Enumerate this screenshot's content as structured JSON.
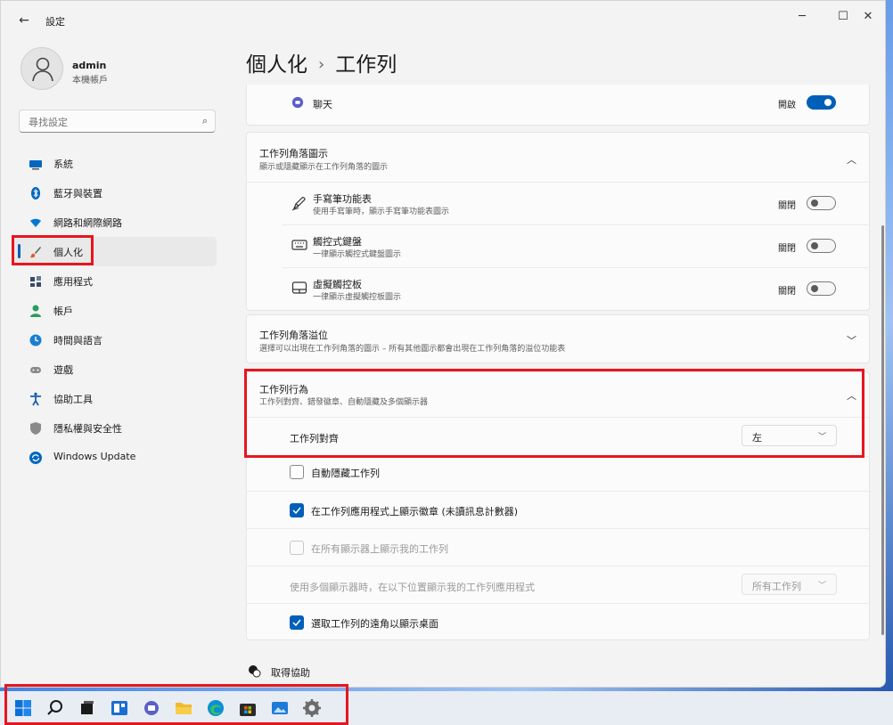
{
  "window": {
    "title": "設定",
    "back_icon": "back-arrow-icon"
  },
  "controls": {
    "minimize": "─",
    "maximize": "☐",
    "close": "✕"
  },
  "user": {
    "name": "admin",
    "account_type": "本機帳戶"
  },
  "search": {
    "placeholder": "尋找設定",
    "icon": "⌕"
  },
  "nav": [
    {
      "label": "系統",
      "icon": "system-icon",
      "color": "#0067c0"
    },
    {
      "label": "藍牙與裝置",
      "icon": "bluetooth-icon",
      "color": "#0067c0"
    },
    {
      "label": "網路和網際網路",
      "icon": "network-icon",
      "color": "#0078d4"
    },
    {
      "label": "個人化",
      "icon": "brush-icon",
      "color": "#e05a2b",
      "active": true
    },
    {
      "label": "應用程式",
      "icon": "apps-icon",
      "color": "#3a4a6a"
    },
    {
      "label": "帳戶",
      "icon": "account-icon",
      "color": "#2a9d5c"
    },
    {
      "label": "時間與語言",
      "icon": "time-language-icon",
      "color": "#1a7fd4"
    },
    {
      "label": "遊戲",
      "icon": "gaming-icon",
      "color": "#7a7a7a"
    },
    {
      "label": "協助工具",
      "icon": "accessibility-icon",
      "color": "#1a5fb4"
    },
    {
      "label": "隱私權與安全性",
      "icon": "shield-icon",
      "color": "#6b6b6b"
    },
    {
      "label": "Windows Update",
      "icon": "windows-update-icon",
      "color": "#0067c0"
    }
  ],
  "breadcrumb": {
    "parent": "個人化",
    "separator": "›",
    "current": "工作列"
  },
  "chat": {
    "label": "聊天",
    "state": "開啟"
  },
  "corner_icons": {
    "title": "工作列角落圖示",
    "subtitle": "顯示或隱藏顯示在工作列角落的圖示",
    "items": [
      {
        "title": "手寫筆功能表",
        "subtitle": "使用手寫筆時，顯示手寫筆功能表圖示",
        "state": "關閉"
      },
      {
        "title": "觸控式鍵盤",
        "subtitle": "一律顯示觸控式鍵盤圖示",
        "state": "關閉"
      },
      {
        "title": "虛擬觸控板",
        "subtitle": "一律顯示虛擬觸控板圖示",
        "state": "關閉"
      }
    ]
  },
  "overflow": {
    "title": "工作列角落溢位",
    "subtitle": "選擇可以出現在工作列角落的圖示 – 所有其他圖示都會出現在工作列角落的溢位功能表"
  },
  "behaviors": {
    "title": "工作列行為",
    "subtitle": "工作列對齊、錯發徽章、自動隱藏及多個顯示器",
    "alignment_label": "工作列對齊",
    "alignment_value": "左",
    "auto_hide": "自動隱藏工作列",
    "badges": "在工作列應用程式上顯示徽章 (未讀訊息計數器)",
    "all_displays": "在所有顯示器上顯示我的工作列",
    "multi_display_label": "使用多個顯示器時，在以下位置顯示我的工作列應用程式",
    "multi_display_value": "所有工作列",
    "far_corner": "選取工作列的遠角以顯示桌面"
  },
  "help": {
    "label": "取得協助"
  },
  "taskbar": [
    "start-icon",
    "search-icon",
    "task-view-icon",
    "widgets-icon",
    "chat-icon",
    "file-explorer-icon",
    "edge-icon",
    "store-icon",
    "photos-icon",
    "settings-icon"
  ]
}
